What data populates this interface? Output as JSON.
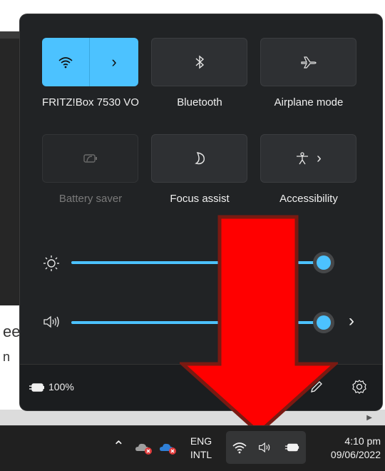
{
  "background": {
    "text_1": "ee",
    "text_2": "n"
  },
  "quick_settings": {
    "tiles": [
      {
        "label": "FRITZ!Box 7530 VO",
        "icon": "wifi-icon",
        "active": true
      },
      {
        "label": "Bluetooth",
        "icon": "bluetooth-icon",
        "active": false
      },
      {
        "label": "Airplane mode",
        "icon": "airplane-icon",
        "active": false
      },
      {
        "label": "Battery saver",
        "icon": "battery-saver-icon",
        "disabled": true
      },
      {
        "label": "Focus assist",
        "icon": "moon-icon",
        "active": false
      },
      {
        "label": "Accessibility",
        "icon": "accessibility-icon",
        "active": false
      }
    ],
    "brightness": {
      "icon": "brightness-icon",
      "level": 1.0
    },
    "volume": {
      "icon": "speaker-icon",
      "level": 1.0
    },
    "battery_percent": "100%"
  },
  "taskbar": {
    "language_line1": "ENG",
    "language_line2": "INTL",
    "time": "4:10 pm",
    "date": "09/06/2022"
  },
  "colors": {
    "accent": "#4cc2ff",
    "panel": "#212325",
    "annotation_arrow": "#ff0000"
  }
}
